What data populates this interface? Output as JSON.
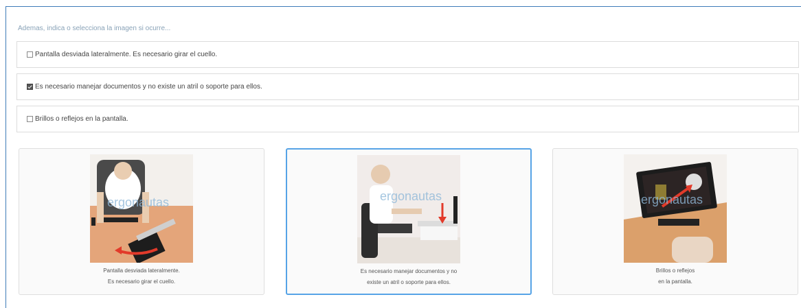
{
  "prompt": "Ademas, indica o selecciona la imagen si ocurre...",
  "options": [
    {
      "label": "Pantalla desviada lateralmente. Es necesario girar el cuello.",
      "checked": false
    },
    {
      "label": "Es necesario manejar documentos y no existe un atril o soporte para ellos.",
      "checked": true
    },
    {
      "label": "Brillos o reflejos en la pantalla.",
      "checked": false
    }
  ],
  "cards": [
    {
      "line1": "Pantalla desviada lateralmente.",
      "line2": "Es necesario girar el cuello.",
      "watermark": "ergonautas",
      "selected": false
    },
    {
      "line1": "Es necesario manejar documentos y no",
      "line2": "existe un atril o soporte para ellos.",
      "watermark": "ergonautas",
      "selected": true
    },
    {
      "line1": "Brillos o reflejos",
      "line2": "en la pantalla.",
      "watermark": "ergonautas",
      "selected": false
    }
  ]
}
